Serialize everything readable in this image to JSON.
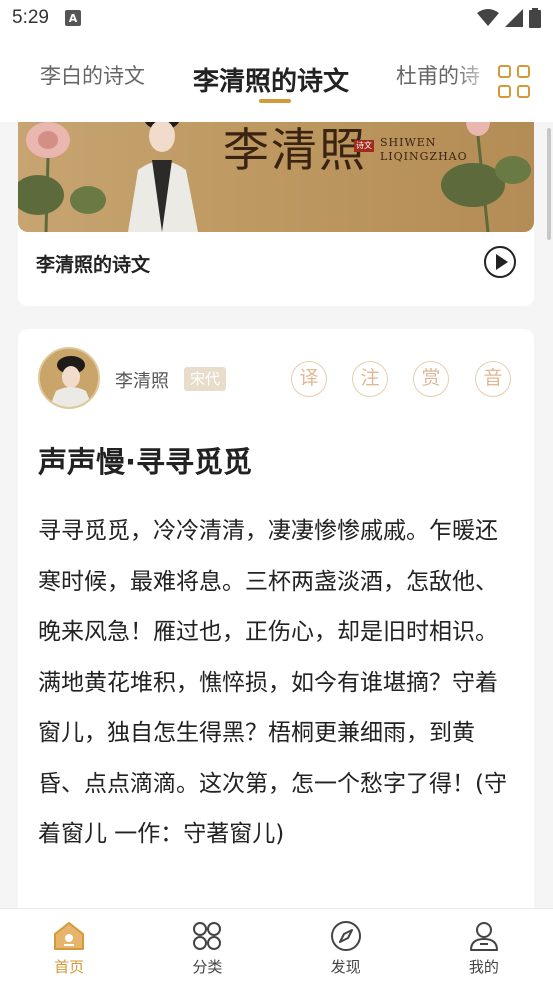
{
  "status_bar": {
    "time": "5:29",
    "notif_label": "A"
  },
  "tabs": [
    {
      "label": "李白的诗文"
    },
    {
      "label": "李清照的诗文"
    },
    {
      "label": "杜甫的诗"
    }
  ],
  "featured": {
    "banner_title": "李清照",
    "banner_seal": "诗文",
    "banner_latin_1": "SHIWEN",
    "banner_latin_2": "LIQINGZHAO",
    "card_title": "李清照的诗文"
  },
  "poem": {
    "author": "李清照",
    "dynasty": "宋代",
    "actions": [
      "译",
      "注",
      "赏",
      "音"
    ],
    "title": "声声慢·寻寻觅觅",
    "lines": [
      "寻寻觅觅，冷冷清清，凄凄惨惨戚戚。乍暖还寒时候，最难将息。三杯两盏淡酒，怎敌他、晚来风急！雁过也，正伤心，却是旧时相识。",
      "满地黄花堆积，憔悴损，如今有谁堪摘？守着窗儿，独自怎生得黑？梧桐更兼细雨，到黄昏、点点滴滴。这次第，怎一个愁字了得！(守着窗儿 一作：守著窗儿)"
    ]
  },
  "bottom_nav": [
    {
      "label": "首页",
      "icon": "home-icon"
    },
    {
      "label": "分类",
      "icon": "category-icon"
    },
    {
      "label": "发现",
      "icon": "compass-icon"
    },
    {
      "label": "我的",
      "icon": "user-icon"
    }
  ],
  "colors": {
    "accent": "#d49a3a",
    "badge": "#e8dccb",
    "action_ring": "#e8cdb0"
  }
}
